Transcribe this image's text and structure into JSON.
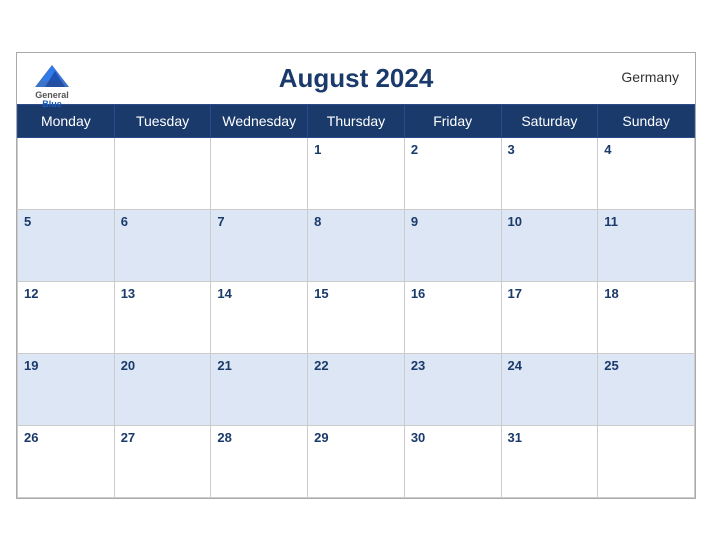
{
  "header": {
    "title": "August 2024",
    "country": "Germany",
    "brand_general": "General",
    "brand_blue": "Blue"
  },
  "weekdays": [
    "Monday",
    "Tuesday",
    "Wednesday",
    "Thursday",
    "Friday",
    "Saturday",
    "Sunday"
  ],
  "weeks": [
    [
      "",
      "",
      "",
      "1",
      "2",
      "3",
      "4"
    ],
    [
      "5",
      "6",
      "7",
      "8",
      "9",
      "10",
      "11"
    ],
    [
      "12",
      "13",
      "14",
      "15",
      "16",
      "17",
      "18"
    ],
    [
      "19",
      "20",
      "21",
      "22",
      "23",
      "24",
      "25"
    ],
    [
      "26",
      "27",
      "28",
      "29",
      "30",
      "31",
      ""
    ]
  ]
}
